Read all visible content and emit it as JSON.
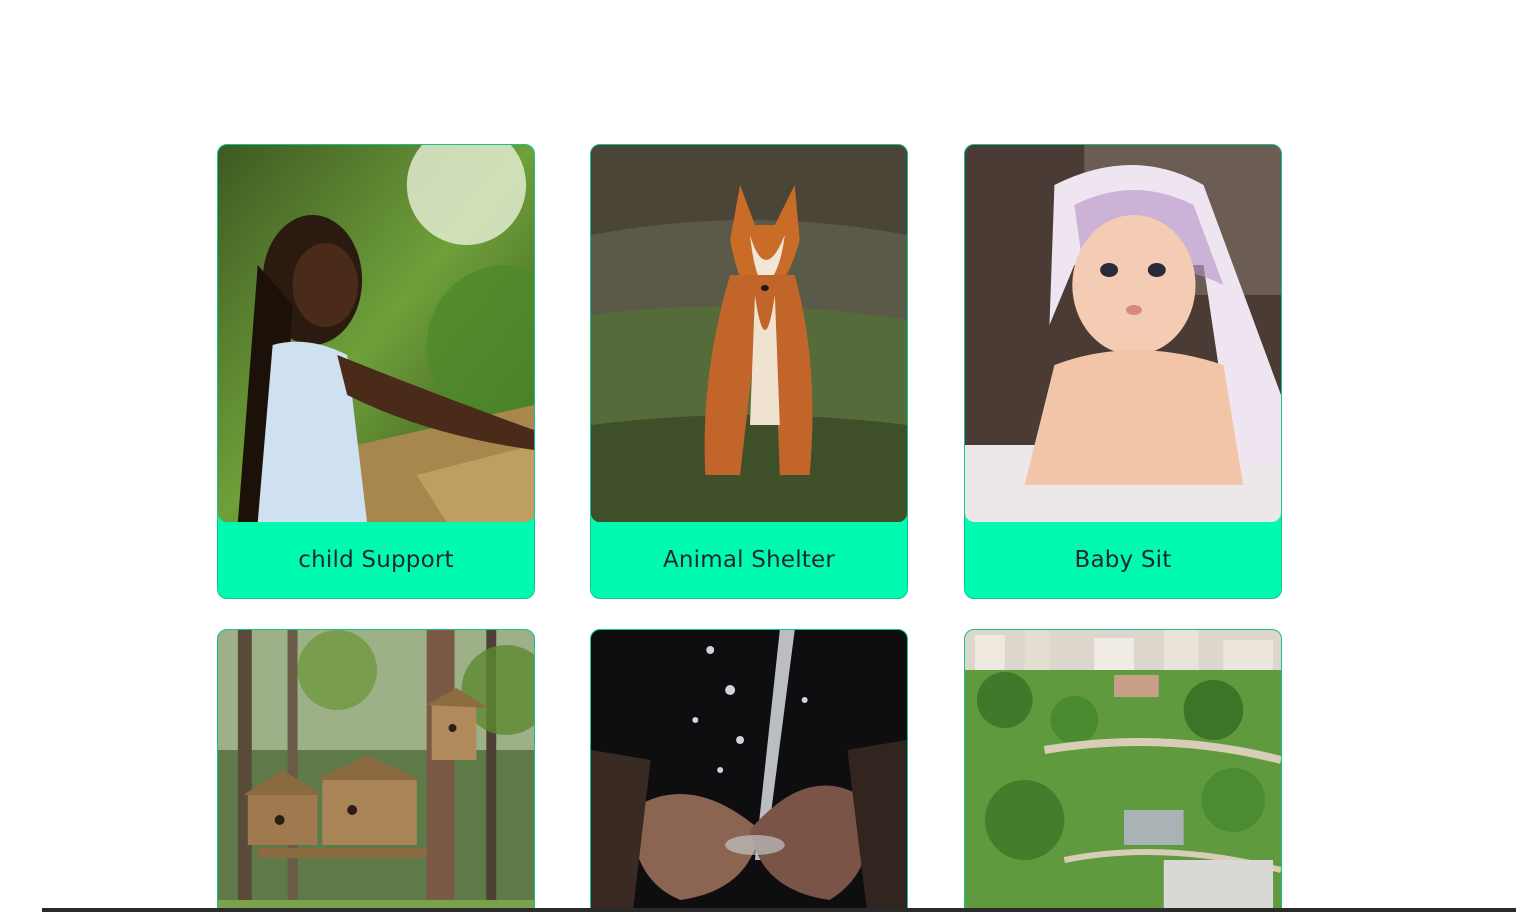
{
  "cards": [
    {
      "label": "child Support",
      "image": "girl-outdoors-photo"
    },
    {
      "label": "Animal Shelter",
      "image": "fox-photo"
    },
    {
      "label": "Baby Sit",
      "image": "baby-blanket-photo"
    },
    {
      "label": "",
      "image": "birdhouses-forest-photo"
    },
    {
      "label": "",
      "image": "water-hands-photo"
    },
    {
      "label": "",
      "image": "city-park-aerial-photo"
    }
  ],
  "colors": {
    "card_footer": "#00fab0",
    "card_border": "#12c48e",
    "label_text": "#1e2a2a"
  }
}
